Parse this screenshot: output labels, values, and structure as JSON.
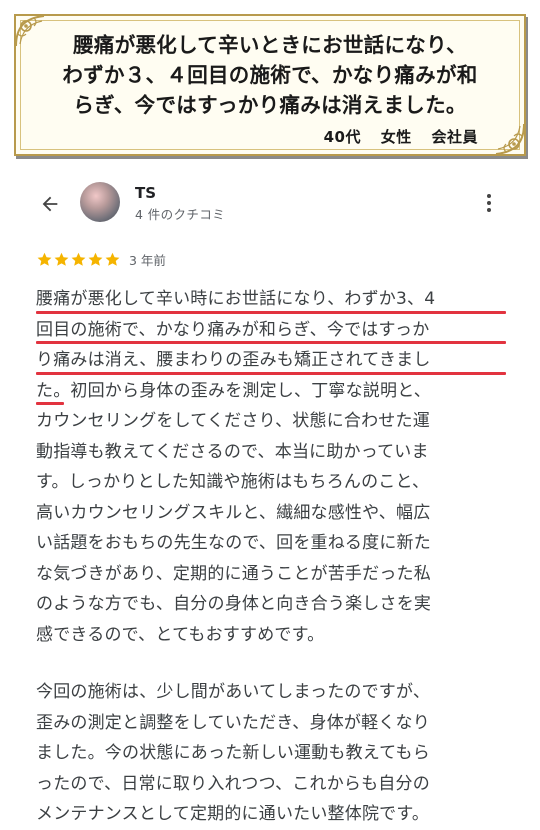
{
  "quote": {
    "lines": [
      "腰痛が悪化して辛いときにお世話になり、",
      "わずか３、４回目の施術で、かなり痛みが和",
      "らぎ、今ではすっかり痛みは消えました。"
    ],
    "attribution": {
      "age": "40代",
      "gender": "女性",
      "occupation": "会社員"
    }
  },
  "review": {
    "reviewer_name": "TS",
    "review_count": "4 件のクチコミ",
    "stars": 5,
    "date": "3 年前",
    "colors": {
      "star": "#f5b400",
      "underline": "#e2333f",
      "frame_gold": "#b89a4c"
    },
    "paragraph1_lines": [
      "腰痛が悪化して辛い時にお世話になり、わずか3、4",
      "回目の施術で、かなり痛みが和らぎ、今ではすっか",
      "り痛みは消え、腰まわりの歪みも矯正されてきまし",
      "た。初回から身体の歪みを測定し、丁寧な説明と、",
      "カウンセリングをしてくださり、状態に合わせた運",
      "動指導も教えてくださるので、本当に助かっていま",
      "す。しっかりとした知識や施術はもちろんのこと、",
      "高いカウンセリングスキルと、繊細な感性や、幅広",
      "い話題をおもちの先生なので、回を重ねる度に新た",
      "な気づきがあり、定期的に通うことが苦手だった私",
      "のような方でも、自分の身体と向き合う楽しさを実",
      "感できるので、とてもおすすめです。"
    ],
    "paragraph2_lines": [
      "今回の施術は、少し間があいてしまったのですが、",
      "歪みの測定と調整をしていただき、身体が軽くなり",
      "ました。今の状態にあった新しい運動も教えてもら",
      "ったので、日常に取り入れつつ、これからも自分の",
      "メンテナンスとして定期的に通いたい整体院です。"
    ]
  },
  "icons": {
    "back": "arrow-left-icon",
    "more": "more-vert-icon",
    "star": "star-icon",
    "ornament": "ornament-corner-icon"
  }
}
